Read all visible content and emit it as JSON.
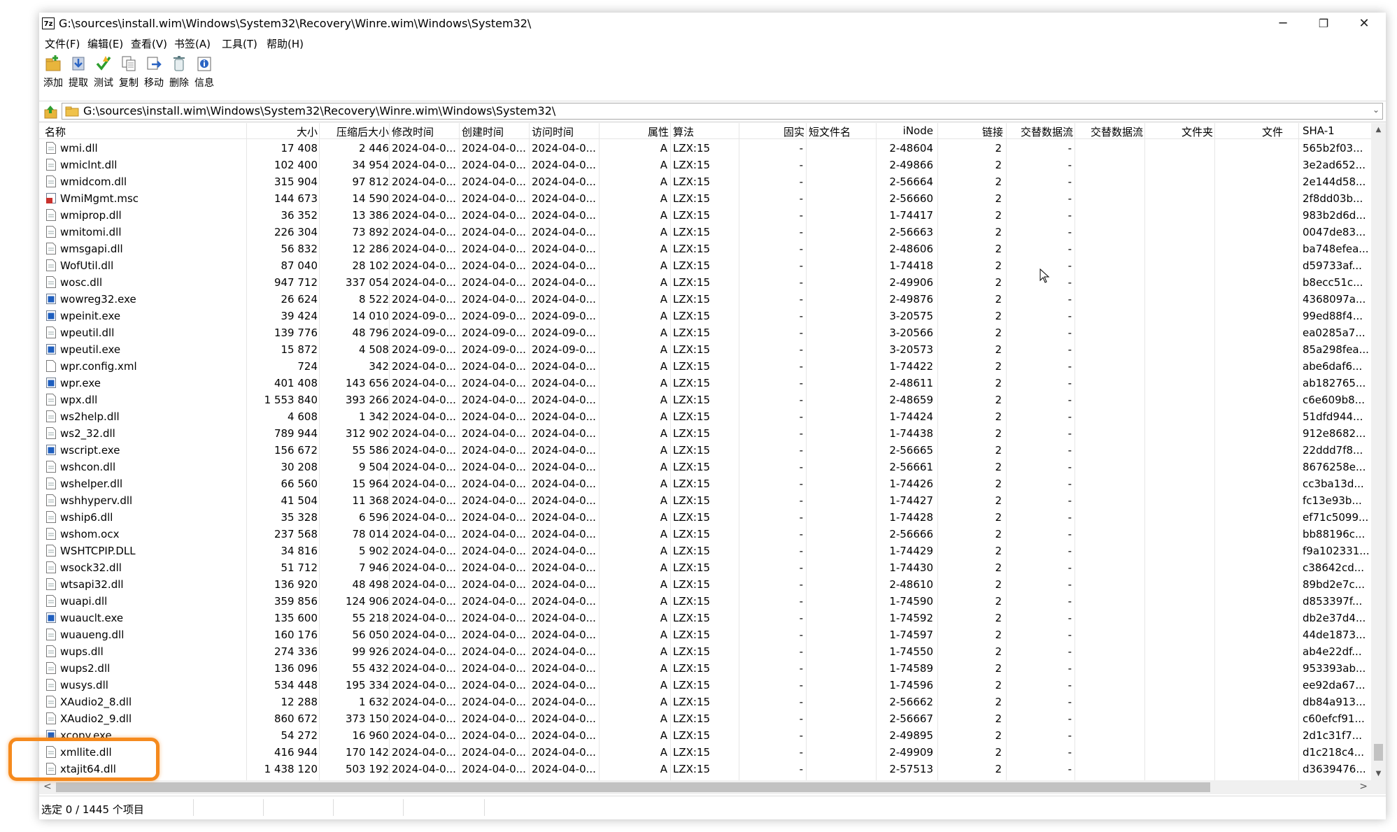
{
  "window": {
    "title": "G:\\sources\\install.wim\\Windows\\System32\\Recovery\\Winre.wim\\Windows\\System32\\",
    "app_icon_text": "7z",
    "controls": {
      "minimize": "─",
      "maximize": "❐",
      "close": "✕"
    }
  },
  "menu": [
    "文件(F)",
    "编辑(E)",
    "查看(V)",
    "书签(A)",
    "工具(T)",
    "帮助(H)"
  ],
  "toolbar": [
    "添加",
    "提取",
    "测试",
    "复制",
    "移动",
    "删除",
    "信息"
  ],
  "address": {
    "path": "G:\\sources\\install.wim\\Windows\\System32\\Recovery\\Winre.wim\\Windows\\System32\\"
  },
  "columns": [
    "名称",
    "大小",
    "压缩后大小",
    "修改时间",
    "创建时间",
    "访问时间",
    "属性",
    "算法",
    "固实",
    "短文件名",
    "iNode",
    "链接",
    "交替数据流",
    "交替数据流",
    "文件夹",
    "文件",
    "SHA-1"
  ],
  "rows": [
    {
      "name": "wmi.dll",
      "type": "dll",
      "size": "17 408",
      "packed": "2 446",
      "mtime": "2024-04-0...",
      "ctime": "2024-04-0...",
      "atime": "2024-04-0...",
      "attr": "A",
      "method": "LZX:15",
      "solid": "-",
      "inode": "2-48604",
      "links": "2",
      "alt": "-",
      "sha1": "565b2f03..."
    },
    {
      "name": "wmiclnt.dll",
      "type": "dll",
      "size": "102 400",
      "packed": "34 954",
      "mtime": "2024-04-0...",
      "ctime": "2024-04-0...",
      "atime": "2024-04-0...",
      "attr": "A",
      "method": "LZX:15",
      "solid": "-",
      "inode": "2-49866",
      "links": "2",
      "alt": "-",
      "sha1": "3e2ad652..."
    },
    {
      "name": "wmidcom.dll",
      "type": "dll",
      "size": "315 904",
      "packed": "97 812",
      "mtime": "2024-04-0...",
      "ctime": "2024-04-0...",
      "atime": "2024-04-0...",
      "attr": "A",
      "method": "LZX:15",
      "solid": "-",
      "inode": "2-56664",
      "links": "2",
      "alt": "-",
      "sha1": "2e144d58..."
    },
    {
      "name": "WmiMgmt.msc",
      "type": "msc",
      "size": "144 673",
      "packed": "14 590",
      "mtime": "2024-04-0...",
      "ctime": "2024-04-0...",
      "atime": "2024-04-0...",
      "attr": "A",
      "method": "LZX:15",
      "solid": "-",
      "inode": "2-56660",
      "links": "2",
      "alt": "-",
      "sha1": "2f8dd03b..."
    },
    {
      "name": "wmiprop.dll",
      "type": "dll",
      "size": "36 352",
      "packed": "13 386",
      "mtime": "2024-04-0...",
      "ctime": "2024-04-0...",
      "atime": "2024-04-0...",
      "attr": "A",
      "method": "LZX:15",
      "solid": "-",
      "inode": "1-74417",
      "links": "2",
      "alt": "-",
      "sha1": "983b2d6d..."
    },
    {
      "name": "wmitomi.dll",
      "type": "dll",
      "size": "226 304",
      "packed": "73 892",
      "mtime": "2024-04-0...",
      "ctime": "2024-04-0...",
      "atime": "2024-04-0...",
      "attr": "A",
      "method": "LZX:15",
      "solid": "-",
      "inode": "2-56663",
      "links": "2",
      "alt": "-",
      "sha1": "0047de83..."
    },
    {
      "name": "wmsgapi.dll",
      "type": "dll",
      "size": "56 832",
      "packed": "12 286",
      "mtime": "2024-04-0...",
      "ctime": "2024-04-0...",
      "atime": "2024-04-0...",
      "attr": "A",
      "method": "LZX:15",
      "solid": "-",
      "inode": "2-48606",
      "links": "2",
      "alt": "-",
      "sha1": "ba748efea..."
    },
    {
      "name": "WofUtil.dll",
      "type": "dll",
      "size": "87 040",
      "packed": "28 102",
      "mtime": "2024-04-0...",
      "ctime": "2024-04-0...",
      "atime": "2024-04-0...",
      "attr": "A",
      "method": "LZX:15",
      "solid": "-",
      "inode": "1-74418",
      "links": "2",
      "alt": "-",
      "sha1": "d59733af..."
    },
    {
      "name": "wosc.dll",
      "type": "dll",
      "size": "947 712",
      "packed": "337 054",
      "mtime": "2024-04-0...",
      "ctime": "2024-04-0...",
      "atime": "2024-04-0...",
      "attr": "A",
      "method": "LZX:15",
      "solid": "-",
      "inode": "2-49906",
      "links": "2",
      "alt": "-",
      "sha1": "b8ecc51c..."
    },
    {
      "name": "wowreg32.exe",
      "type": "exe",
      "size": "26 624",
      "packed": "8 522",
      "mtime": "2024-04-0...",
      "ctime": "2024-04-0...",
      "atime": "2024-04-0...",
      "attr": "A",
      "method": "LZX:15",
      "solid": "-",
      "inode": "2-49876",
      "links": "2",
      "alt": "-",
      "sha1": "4368097a..."
    },
    {
      "name": "wpeinit.exe",
      "type": "exe",
      "size": "39 424",
      "packed": "14 010",
      "mtime": "2024-09-0...",
      "ctime": "2024-09-0...",
      "atime": "2024-09-0...",
      "attr": "A",
      "method": "LZX:15",
      "solid": "-",
      "inode": "3-20575",
      "links": "2",
      "alt": "-",
      "sha1": "99ed88f4..."
    },
    {
      "name": "wpeutil.dll",
      "type": "dll",
      "size": "139 776",
      "packed": "48 796",
      "mtime": "2024-09-0...",
      "ctime": "2024-09-0...",
      "atime": "2024-09-0...",
      "attr": "A",
      "method": "LZX:15",
      "solid": "-",
      "inode": "3-20566",
      "links": "2",
      "alt": "-",
      "sha1": "ea0285a7..."
    },
    {
      "name": "wpeutil.exe",
      "type": "exe",
      "size": "15 872",
      "packed": "4 508",
      "mtime": "2024-09-0...",
      "ctime": "2024-09-0...",
      "atime": "2024-09-0...",
      "attr": "A",
      "method": "LZX:15",
      "solid": "-",
      "inode": "3-20573",
      "links": "2",
      "alt": "-",
      "sha1": "85a298fea..."
    },
    {
      "name": "wpr.config.xml",
      "type": "xml",
      "size": "724",
      "packed": "342",
      "mtime": "2024-04-0...",
      "ctime": "2024-04-0...",
      "atime": "2024-04-0...",
      "attr": "A",
      "method": "LZX:15",
      "solid": "-",
      "inode": "1-74422",
      "links": "2",
      "alt": "-",
      "sha1": "abe6daf6..."
    },
    {
      "name": "wpr.exe",
      "type": "exe",
      "size": "401 408",
      "packed": "143 656",
      "mtime": "2024-04-0...",
      "ctime": "2024-04-0...",
      "atime": "2024-04-0...",
      "attr": "A",
      "method": "LZX:15",
      "solid": "-",
      "inode": "2-48611",
      "links": "2",
      "alt": "-",
      "sha1": "ab182765..."
    },
    {
      "name": "wpx.dll",
      "type": "dll",
      "size": "1 553 840",
      "packed": "393 266",
      "mtime": "2024-04-0...",
      "ctime": "2024-04-0...",
      "atime": "2024-04-0...",
      "attr": "A",
      "method": "LZX:15",
      "solid": "-",
      "inode": "2-48659",
      "links": "2",
      "alt": "-",
      "sha1": "c6e609b8..."
    },
    {
      "name": "ws2help.dll",
      "type": "dll",
      "size": "4 608",
      "packed": "1 342",
      "mtime": "2024-04-0...",
      "ctime": "2024-04-0...",
      "atime": "2024-04-0...",
      "attr": "A",
      "method": "LZX:15",
      "solid": "-",
      "inode": "1-74424",
      "links": "2",
      "alt": "-",
      "sha1": "51dfd944..."
    },
    {
      "name": "ws2_32.dll",
      "type": "dll",
      "size": "789 944",
      "packed": "312 902",
      "mtime": "2024-04-0...",
      "ctime": "2024-04-0...",
      "atime": "2024-04-0...",
      "attr": "A",
      "method": "LZX:15",
      "solid": "-",
      "inode": "1-74438",
      "links": "2",
      "alt": "-",
      "sha1": "912e8682..."
    },
    {
      "name": "wscript.exe",
      "type": "exe",
      "size": "156 672",
      "packed": "55 586",
      "mtime": "2024-04-0...",
      "ctime": "2024-04-0...",
      "atime": "2024-04-0...",
      "attr": "A",
      "method": "LZX:15",
      "solid": "-",
      "inode": "2-56665",
      "links": "2",
      "alt": "-",
      "sha1": "22ddd7f8..."
    },
    {
      "name": "wshcon.dll",
      "type": "dll",
      "size": "30 208",
      "packed": "9 504",
      "mtime": "2024-04-0...",
      "ctime": "2024-04-0...",
      "atime": "2024-04-0...",
      "attr": "A",
      "method": "LZX:15",
      "solid": "-",
      "inode": "2-56661",
      "links": "2",
      "alt": "-",
      "sha1": "8676258e..."
    },
    {
      "name": "wshelper.dll",
      "type": "dll",
      "size": "66 560",
      "packed": "15 964",
      "mtime": "2024-04-0...",
      "ctime": "2024-04-0...",
      "atime": "2024-04-0...",
      "attr": "A",
      "method": "LZX:15",
      "solid": "-",
      "inode": "1-74426",
      "links": "2",
      "alt": "-",
      "sha1": "cc3ba13d..."
    },
    {
      "name": "wshhyperv.dll",
      "type": "dll",
      "size": "41 504",
      "packed": "11 368",
      "mtime": "2024-04-0...",
      "ctime": "2024-04-0...",
      "atime": "2024-04-0...",
      "attr": "A",
      "method": "LZX:15",
      "solid": "-",
      "inode": "1-74427",
      "links": "2",
      "alt": "-",
      "sha1": "fc13e93b..."
    },
    {
      "name": "wship6.dll",
      "type": "dll",
      "size": "35 328",
      "packed": "6 596",
      "mtime": "2024-04-0...",
      "ctime": "2024-04-0...",
      "atime": "2024-04-0...",
      "attr": "A",
      "method": "LZX:15",
      "solid": "-",
      "inode": "1-74428",
      "links": "2",
      "alt": "-",
      "sha1": "ef71c5099..."
    },
    {
      "name": "wshom.ocx",
      "type": "dll",
      "size": "237 568",
      "packed": "78 014",
      "mtime": "2024-04-0...",
      "ctime": "2024-04-0...",
      "atime": "2024-04-0...",
      "attr": "A",
      "method": "LZX:15",
      "solid": "-",
      "inode": "2-56666",
      "links": "2",
      "alt": "-",
      "sha1": "bb88196c..."
    },
    {
      "name": "WSHTCPIP.DLL",
      "type": "dll",
      "size": "34 816",
      "packed": "5 902",
      "mtime": "2024-04-0...",
      "ctime": "2024-04-0...",
      "atime": "2024-04-0...",
      "attr": "A",
      "method": "LZX:15",
      "solid": "-",
      "inode": "1-74429",
      "links": "2",
      "alt": "-",
      "sha1": "f9a102331..."
    },
    {
      "name": "wsock32.dll",
      "type": "dll",
      "size": "51 712",
      "packed": "7 946",
      "mtime": "2024-04-0...",
      "ctime": "2024-04-0...",
      "atime": "2024-04-0...",
      "attr": "A",
      "method": "LZX:15",
      "solid": "-",
      "inode": "1-74430",
      "links": "2",
      "alt": "-",
      "sha1": "c38642cd..."
    },
    {
      "name": "wtsapi32.dll",
      "type": "dll",
      "size": "136 920",
      "packed": "48 498",
      "mtime": "2024-04-0...",
      "ctime": "2024-04-0...",
      "atime": "2024-04-0...",
      "attr": "A",
      "method": "LZX:15",
      "solid": "-",
      "inode": "2-48610",
      "links": "2",
      "alt": "-",
      "sha1": "89bd2e7c..."
    },
    {
      "name": "wuapi.dll",
      "type": "dll",
      "size": "359 856",
      "packed": "124 906",
      "mtime": "2024-04-0...",
      "ctime": "2024-04-0...",
      "atime": "2024-04-0...",
      "attr": "A",
      "method": "LZX:15",
      "solid": "-",
      "inode": "1-74590",
      "links": "2",
      "alt": "-",
      "sha1": "d853397f..."
    },
    {
      "name": "wuauclt.exe",
      "type": "exe",
      "size": "135 600",
      "packed": "55 218",
      "mtime": "2024-04-0...",
      "ctime": "2024-04-0...",
      "atime": "2024-04-0...",
      "attr": "A",
      "method": "LZX:15",
      "solid": "-",
      "inode": "1-74592",
      "links": "2",
      "alt": "-",
      "sha1": "db2e37d4..."
    },
    {
      "name": "wuaueng.dll",
      "type": "dll",
      "size": "160 176",
      "packed": "56 050",
      "mtime": "2024-04-0...",
      "ctime": "2024-04-0...",
      "atime": "2024-04-0...",
      "attr": "A",
      "method": "LZX:15",
      "solid": "-",
      "inode": "1-74597",
      "links": "2",
      "alt": "-",
      "sha1": "44de1873..."
    },
    {
      "name": "wups.dll",
      "type": "dll",
      "size": "274 336",
      "packed": "99 926",
      "mtime": "2024-04-0...",
      "ctime": "2024-04-0...",
      "atime": "2024-04-0...",
      "attr": "A",
      "method": "LZX:15",
      "solid": "-",
      "inode": "1-74550",
      "links": "2",
      "alt": "-",
      "sha1": "ab4e22df..."
    },
    {
      "name": "wups2.dll",
      "type": "dll",
      "size": "136 096",
      "packed": "55 432",
      "mtime": "2024-04-0...",
      "ctime": "2024-04-0...",
      "atime": "2024-04-0...",
      "attr": "A",
      "method": "LZX:15",
      "solid": "-",
      "inode": "1-74589",
      "links": "2",
      "alt": "-",
      "sha1": "953393ab..."
    },
    {
      "name": "wusys.dll",
      "type": "dll",
      "size": "534 448",
      "packed": "195 334",
      "mtime": "2024-04-0...",
      "ctime": "2024-04-0...",
      "atime": "2024-04-0...",
      "attr": "A",
      "method": "LZX:15",
      "solid": "-",
      "inode": "1-74596",
      "links": "2",
      "alt": "-",
      "sha1": "ee92da67..."
    },
    {
      "name": "XAudio2_8.dll",
      "type": "dll",
      "size": "12 288",
      "packed": "1 632",
      "mtime": "2024-04-0...",
      "ctime": "2024-04-0...",
      "atime": "2024-04-0...",
      "attr": "A",
      "method": "LZX:15",
      "solid": "-",
      "inode": "2-56662",
      "links": "2",
      "alt": "-",
      "sha1": "db84a913..."
    },
    {
      "name": "XAudio2_9.dll",
      "type": "dll",
      "size": "860 672",
      "packed": "373 150",
      "mtime": "2024-04-0...",
      "ctime": "2024-04-0...",
      "atime": "2024-04-0...",
      "attr": "A",
      "method": "LZX:15",
      "solid": "-",
      "inode": "2-56667",
      "links": "2",
      "alt": "-",
      "sha1": "c60efcf91..."
    },
    {
      "name": "xcopy.exe",
      "type": "exe",
      "size": "54 272",
      "packed": "16 960",
      "mtime": "2024-04-0...",
      "ctime": "2024-04-0...",
      "atime": "2024-04-0...",
      "attr": "A",
      "method": "LZX:15",
      "solid": "-",
      "inode": "2-49895",
      "links": "2",
      "alt": "-",
      "sha1": "2d1c31f7..."
    },
    {
      "name": "xmllite.dll",
      "type": "dll",
      "size": "416 944",
      "packed": "170 142",
      "mtime": "2024-04-0...",
      "ctime": "2024-04-0...",
      "atime": "2024-04-0...",
      "attr": "A",
      "method": "LZX:15",
      "solid": "-",
      "inode": "2-49909",
      "links": "2",
      "alt": "-",
      "sha1": "d1c218c4..."
    },
    {
      "name": "xtajit64.dll",
      "type": "dll",
      "size": "1 438 120",
      "packed": "503 192",
      "mtime": "2024-04-0...",
      "ctime": "2024-04-0...",
      "atime": "2024-04-0...",
      "attr": "A",
      "method": "LZX:15",
      "solid": "-",
      "inode": "2-57513",
      "links": "2",
      "alt": "-",
      "sha1": "d3639476..."
    }
  ],
  "status": {
    "selection": "选定 0 / 1445 个项目"
  },
  "colors": {
    "highlight": "#f58a1e",
    "exe_icon": "#1f5fbf",
    "msc_icon": "#c8312c"
  }
}
